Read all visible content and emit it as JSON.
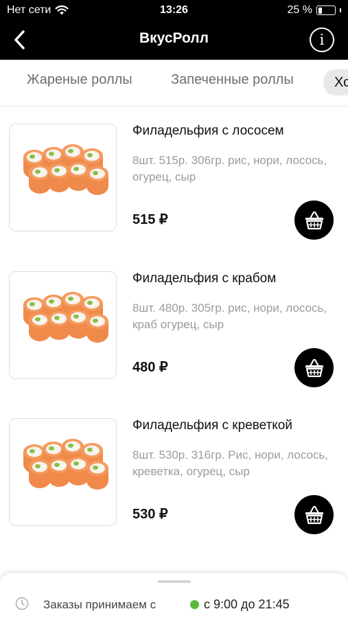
{
  "status_bar": {
    "carrier": "Нет сети",
    "time": "13:26",
    "battery_percent": "25 %",
    "battery_level": 0.25
  },
  "header": {
    "title": "ВкусРолл",
    "back_icon": "chevron-left-icon",
    "info_icon": "info-icon",
    "info_glyph": "i"
  },
  "category_tabs": [
    {
      "label": "Жареные роллы"
    },
    {
      "label": "Запеченные роллы"
    },
    {
      "label": "Хо"
    }
  ],
  "products": [
    {
      "name": "Филадельфия с лососем",
      "description": "8шт. 515р. 306гр. рис, нори, лосось, огурец, сыр",
      "price": "515 ₽"
    },
    {
      "name": "Филадельфия с крабом",
      "description": "8шт. 480р. 305гр. рис, нори, лосось, краб огурец, сыр",
      "price": "480 ₽"
    },
    {
      "name": "Филадельфия с креветкой",
      "description": "8шт. 530р. 316гр. Рис, нори, лосось, креветка, огурец, сыр",
      "price": "530 ₽"
    }
  ],
  "footer": {
    "message": "Заказы принимаем с",
    "hours": "с 9:00 до 21:45",
    "status_color": "#5ab93c"
  },
  "colors": {
    "header_bg": "#000000",
    "salmon": "#f08a4b",
    "rice": "#f6f3ea",
    "cucumber": "#8bbd4a"
  }
}
